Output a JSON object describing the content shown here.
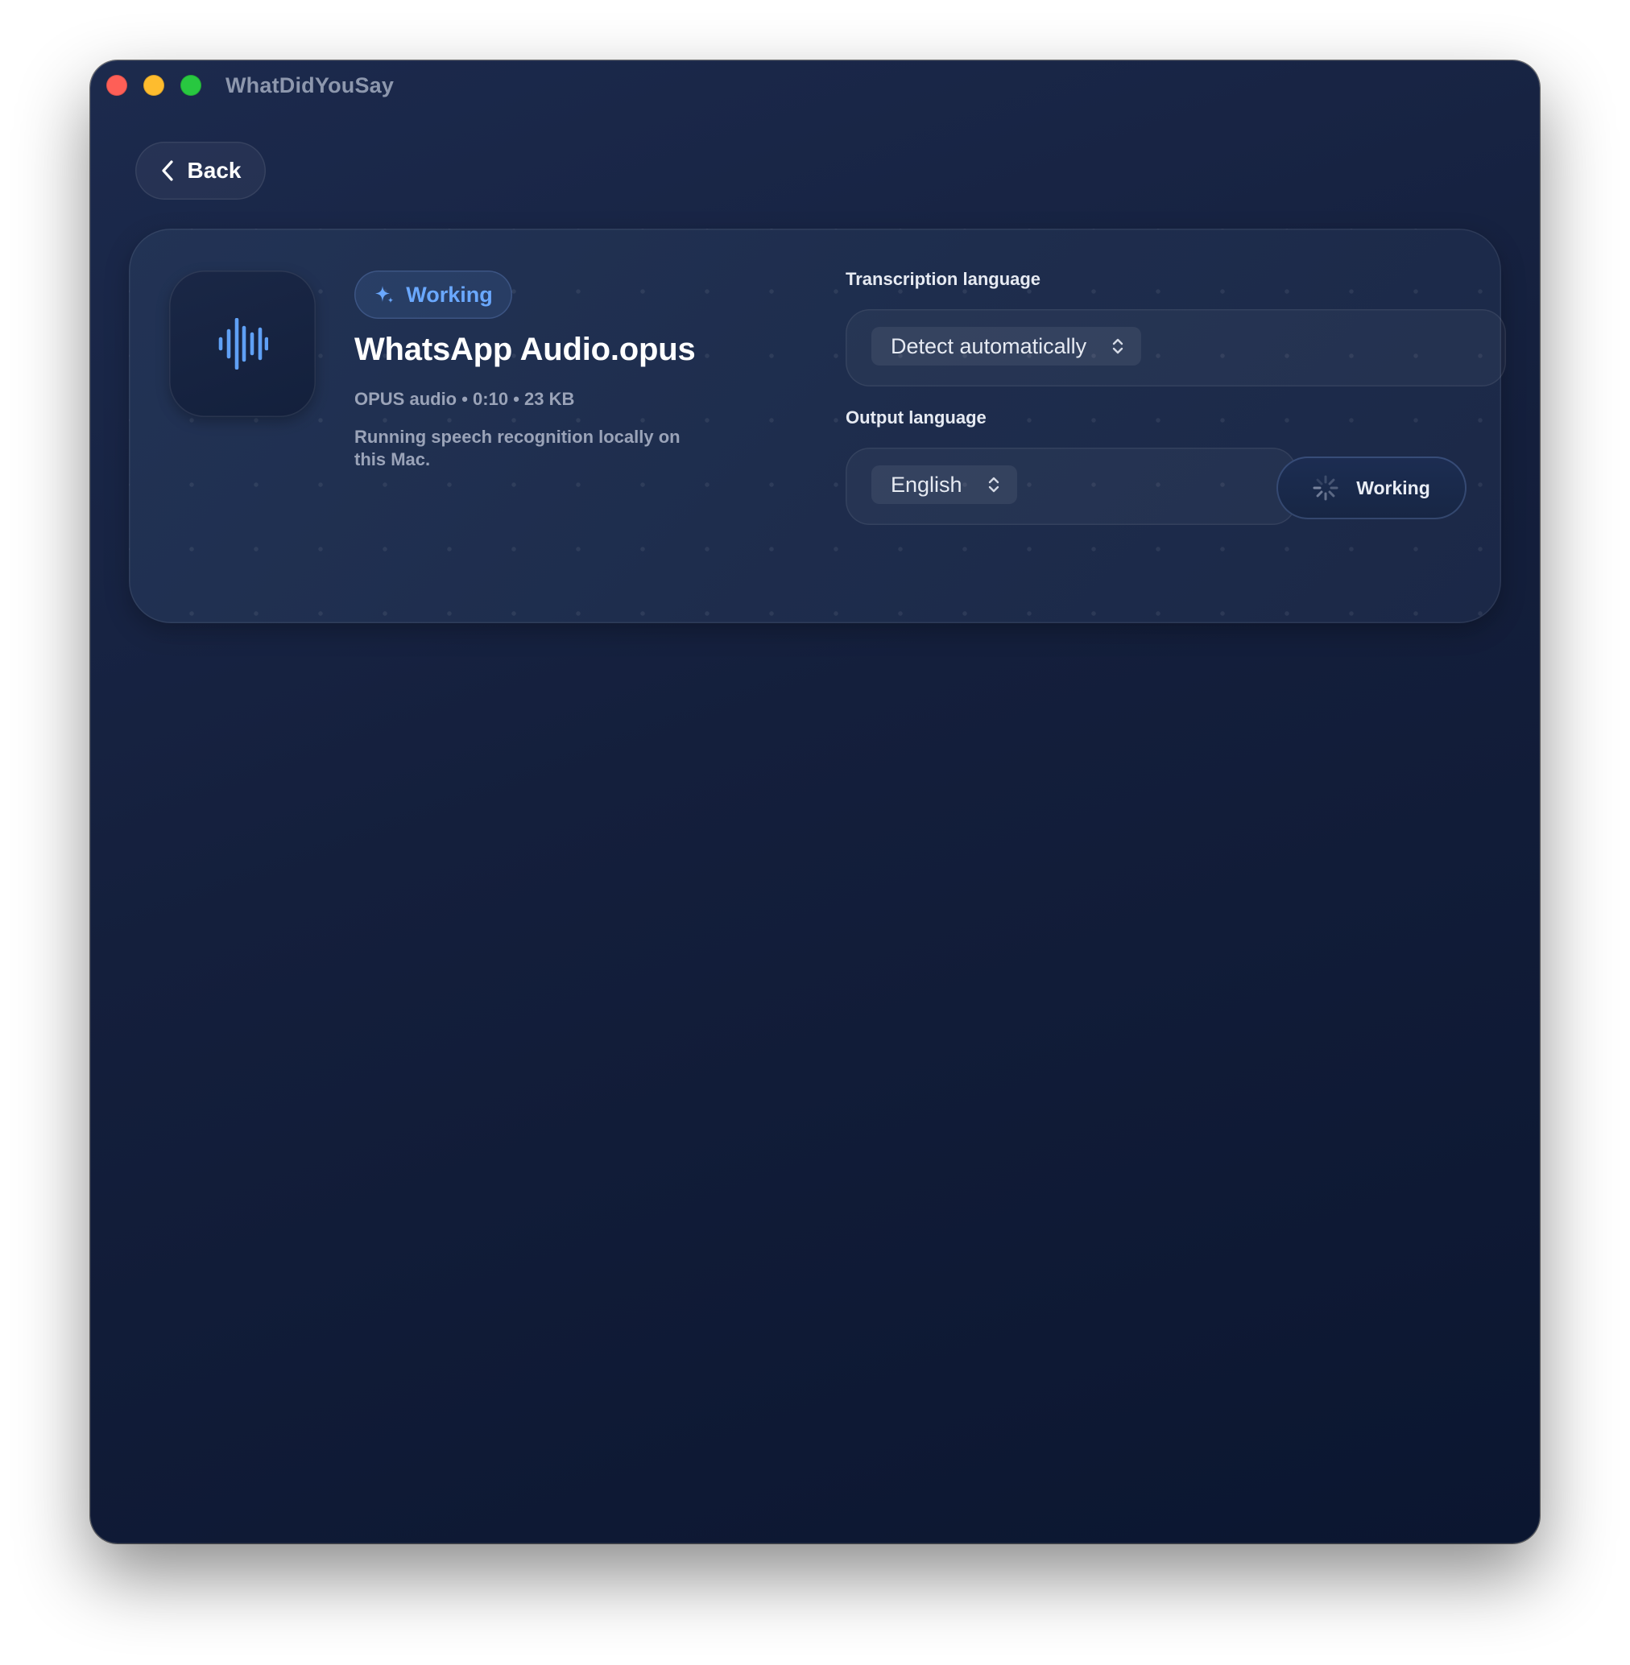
{
  "window": {
    "app_title": "WhatDidYouSay"
  },
  "toolbar": {
    "back_label": "Back"
  },
  "file": {
    "status_badge": "Working",
    "name": "WhatsApp Audio.opus",
    "meta": "OPUS audio • 0:10 • 23 KB",
    "status_text": "Running speech recognition locally on this Mac.",
    "icon": "waveform-icon"
  },
  "settings": {
    "transcription_label": "Transcription language",
    "transcription_value": "Detect automatically",
    "output_label": "Output language",
    "output_value": "English",
    "action_label": "Working"
  },
  "colors": {
    "accent": "#6aa8ff",
    "window_bg": "#141f3c",
    "close": "#fe5f57",
    "minimize": "#febc2e",
    "maximize": "#28c840"
  }
}
